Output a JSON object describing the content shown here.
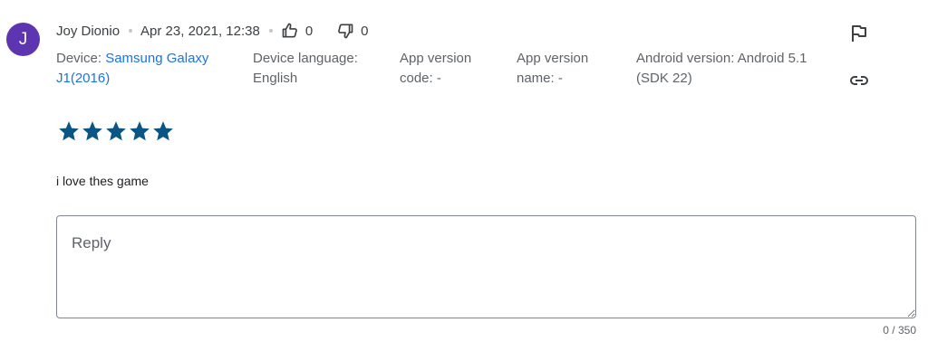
{
  "review": {
    "avatar_letter": "J",
    "author": "Joy Dionio",
    "date": "Apr 23, 2021, 12:38",
    "thumbs_up_count": "0",
    "thumbs_down_count": "0",
    "rating": 5,
    "text": "i love thes game"
  },
  "device": {
    "device_label": "Device:",
    "device_value": "Samsung Galaxy J1(2016)",
    "language_label": "Device language:",
    "language_value": "English",
    "app_code_label": "App version code: -",
    "app_name_label": "App version name: -",
    "android_label": "Android version: Android 5.1 (SDK 22)"
  },
  "reply": {
    "placeholder": "Reply",
    "counter": "0 / 350"
  },
  "colors": {
    "avatar": "#5e35b1",
    "star": "#0b5585",
    "link": "#1a73e8"
  }
}
